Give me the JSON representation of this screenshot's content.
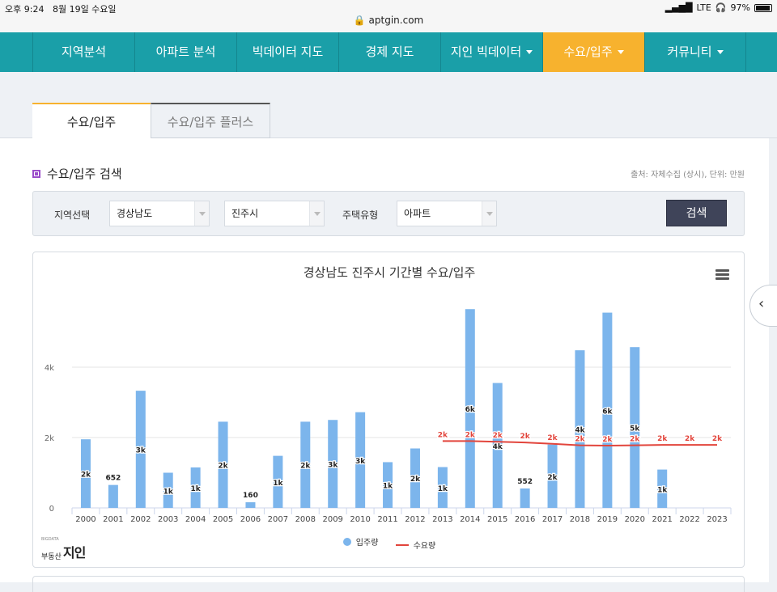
{
  "status": {
    "time": "오후 9:24",
    "date": "8월 19일 수요일",
    "signal": "LTE",
    "battery": "97%"
  },
  "url": "aptgin.com",
  "nav": [
    {
      "label": "지역분석",
      "dropdown": false,
      "active": false
    },
    {
      "label": "아파트 분석",
      "dropdown": false,
      "active": false
    },
    {
      "label": "빅데이터 지도",
      "dropdown": false,
      "active": false
    },
    {
      "label": "경제 지도",
      "dropdown": false,
      "active": false
    },
    {
      "label": "지인 빅데이터",
      "dropdown": true,
      "active": false
    },
    {
      "label": "수요/입주",
      "dropdown": true,
      "active": true
    },
    {
      "label": "커뮤니티",
      "dropdown": true,
      "active": false
    }
  ],
  "tabs": {
    "active": "수요/입주",
    "inactive": "수요/입주 플러스"
  },
  "section": {
    "title": "수요/입주 검색",
    "source": "출처: 자체수집 (상시), 단위: 만원"
  },
  "search": {
    "region_label": "지역선택",
    "province": "경상남도",
    "city": "진주시",
    "housing_label": "주택유형",
    "housing_type": "아파트",
    "button": "검색"
  },
  "logo": {
    "small": "부동산",
    "big": "지인",
    "tiny": "BIGDATA"
  },
  "colors": {
    "teal": "#1a9fa8",
    "orange": "#f7b22e",
    "bar": "#7cb5ec",
    "line": "#e2453c"
  },
  "chart_data": {
    "type": "bar",
    "title": "경상남도 진주시 기간별 수요/입주",
    "categories": [
      "2000",
      "2001",
      "2002",
      "2003",
      "2004",
      "2005",
      "2006",
      "2007",
      "2008",
      "2009",
      "2010",
      "2011",
      "2012",
      "2013",
      "2014",
      "2015",
      "2016",
      "2017",
      "2018",
      "2019",
      "2020",
      "2021",
      "2022",
      "2023"
    ],
    "yticks": [
      "0",
      "2k",
      "4k"
    ],
    "ylim": [
      0,
      6000
    ],
    "series": [
      {
        "name": "입주량",
        "type": "bar",
        "values": [
          1950,
          652,
          3330,
          1000,
          1150,
          2450,
          160,
          1480,
          2450,
          2500,
          2720,
          1300,
          1690,
          1160,
          5650,
          3550,
          552,
          1800,
          4480,
          5550,
          4570,
          1090,
          0,
          0
        ],
        "labels": [
          "2k",
          "652",
          "3k",
          "1k",
          "1k",
          "2k",
          "160",
          "1k",
          "2k",
          "3k",
          "3k",
          "1k",
          "2k",
          "1k",
          "6k",
          "4k",
          "552",
          "2k",
          "4k",
          "6k",
          "5k",
          "1k",
          "",
          ""
        ]
      },
      {
        "name": "수요량",
        "type": "line",
        "start_index": 13,
        "values": [
          1900,
          1900,
          1880,
          1860,
          1820,
          1780,
          1770,
          1780,
          1790,
          1790,
          1790
        ],
        "labels": [
          "2k",
          "2k",
          "2k",
          "2k",
          "2k",
          "2k",
          "2k",
          "2k",
          "2k",
          "2k",
          "2k"
        ]
      }
    ],
    "legend": "bottom-center"
  }
}
